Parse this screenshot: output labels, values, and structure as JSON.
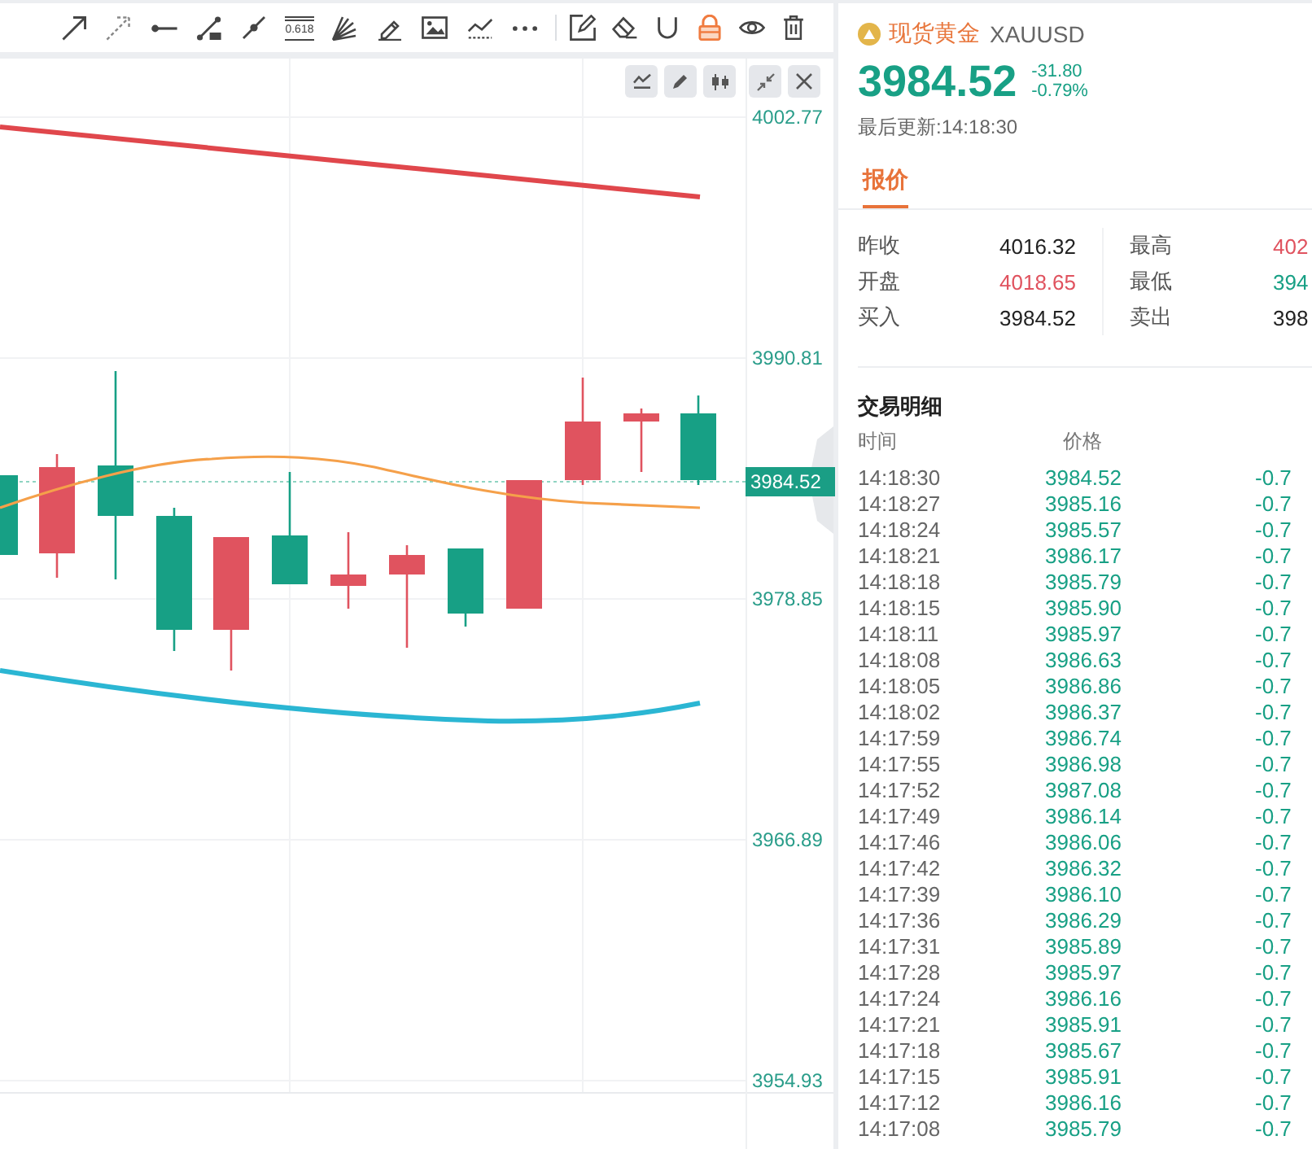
{
  "toolbar": {
    "fib_label": "0.618",
    "lock_on": true
  },
  "chart": {
    "price_labels": [
      "4002.77",
      "3990.81",
      "3978.85",
      "3966.89",
      "3954.93"
    ],
    "last_price": "3984.52"
  },
  "quote": {
    "name": "现货黄金",
    "symbol": "XAUUSD",
    "price": "3984.52",
    "change": "-31.80",
    "change_pct": "-0.79%",
    "updated": "最后更新:14:18:30",
    "color": "#18a085"
  },
  "tabs": [
    {
      "label": "报价",
      "selected": true
    }
  ],
  "stats": [
    [
      {
        "label": "昨收",
        "value": "4016.32",
        "color": "#222222"
      },
      {
        "label": "开盘",
        "value": "4018.65",
        "color": "#e0535f"
      },
      {
        "label": "买入",
        "value": "3984.52",
        "color": "#222222"
      }
    ],
    [
      {
        "label": "最高",
        "value": "402",
        "color": "#e0535f"
      },
      {
        "label": "最低",
        "value": "394",
        "color": "#18a085"
      },
      {
        "label": "卖出",
        "value": "398",
        "color": "#222222"
      }
    ]
  ],
  "trades": {
    "title": "交易明细",
    "columns": [
      "时间",
      "价格"
    ],
    "rows": [
      {
        "time": "14:18:30",
        "price": "3984.52",
        "change": "-0.7",
        "color": "#18a085"
      },
      {
        "time": "14:18:27",
        "price": "3985.16",
        "change": "-0.7",
        "color": "#18a085"
      },
      {
        "time": "14:18:24",
        "price": "3985.57",
        "change": "-0.7",
        "color": "#18a085"
      },
      {
        "time": "14:18:21",
        "price": "3986.17",
        "change": "-0.7",
        "color": "#18a085"
      },
      {
        "time": "14:18:18",
        "price": "3985.79",
        "change": "-0.7",
        "color": "#18a085"
      },
      {
        "time": "14:18:15",
        "price": "3985.90",
        "change": "-0.7",
        "color": "#18a085"
      },
      {
        "time": "14:18:11",
        "price": "3985.97",
        "change": "-0.7",
        "color": "#18a085"
      },
      {
        "time": "14:18:08",
        "price": "3986.63",
        "change": "-0.7",
        "color": "#18a085"
      },
      {
        "time": "14:18:05",
        "price": "3986.86",
        "change": "-0.7",
        "color": "#18a085"
      },
      {
        "time": "14:18:02",
        "price": "3986.37",
        "change": "-0.7",
        "color": "#18a085"
      },
      {
        "time": "14:17:59",
        "price": "3986.74",
        "change": "-0.7",
        "color": "#18a085"
      },
      {
        "time": "14:17:55",
        "price": "3986.98",
        "change": "-0.7",
        "color": "#18a085"
      },
      {
        "time": "14:17:52",
        "price": "3987.08",
        "change": "-0.7",
        "color": "#18a085"
      },
      {
        "time": "14:17:49",
        "price": "3986.14",
        "change": "-0.7",
        "color": "#18a085"
      },
      {
        "time": "14:17:46",
        "price": "3986.06",
        "change": "-0.7",
        "color": "#18a085"
      },
      {
        "time": "14:17:42",
        "price": "3986.32",
        "change": "-0.7",
        "color": "#18a085"
      },
      {
        "time": "14:17:39",
        "price": "3986.10",
        "change": "-0.7",
        "color": "#18a085"
      },
      {
        "time": "14:17:36",
        "price": "3986.29",
        "change": "-0.7",
        "color": "#18a085"
      },
      {
        "time": "14:17:31",
        "price": "3985.89",
        "change": "-0.7",
        "color": "#18a085"
      },
      {
        "time": "14:17:28",
        "price": "3985.97",
        "change": "-0.7",
        "color": "#18a085"
      },
      {
        "time": "14:17:24",
        "price": "3986.16",
        "change": "-0.7",
        "color": "#18a085"
      },
      {
        "time": "14:17:21",
        "price": "3985.91",
        "change": "-0.7",
        "color": "#18a085"
      },
      {
        "time": "14:17:18",
        "price": "3985.67",
        "change": "-0.7",
        "color": "#18a085"
      },
      {
        "time": "14:17:15",
        "price": "3985.91",
        "change": "-0.7",
        "color": "#18a085"
      },
      {
        "time": "14:17:12",
        "price": "3986.16",
        "change": "-0.7",
        "color": "#18a085"
      },
      {
        "time": "14:17:08",
        "price": "3985.79",
        "change": "-0.7",
        "color": "#18a085"
      }
    ]
  }
}
